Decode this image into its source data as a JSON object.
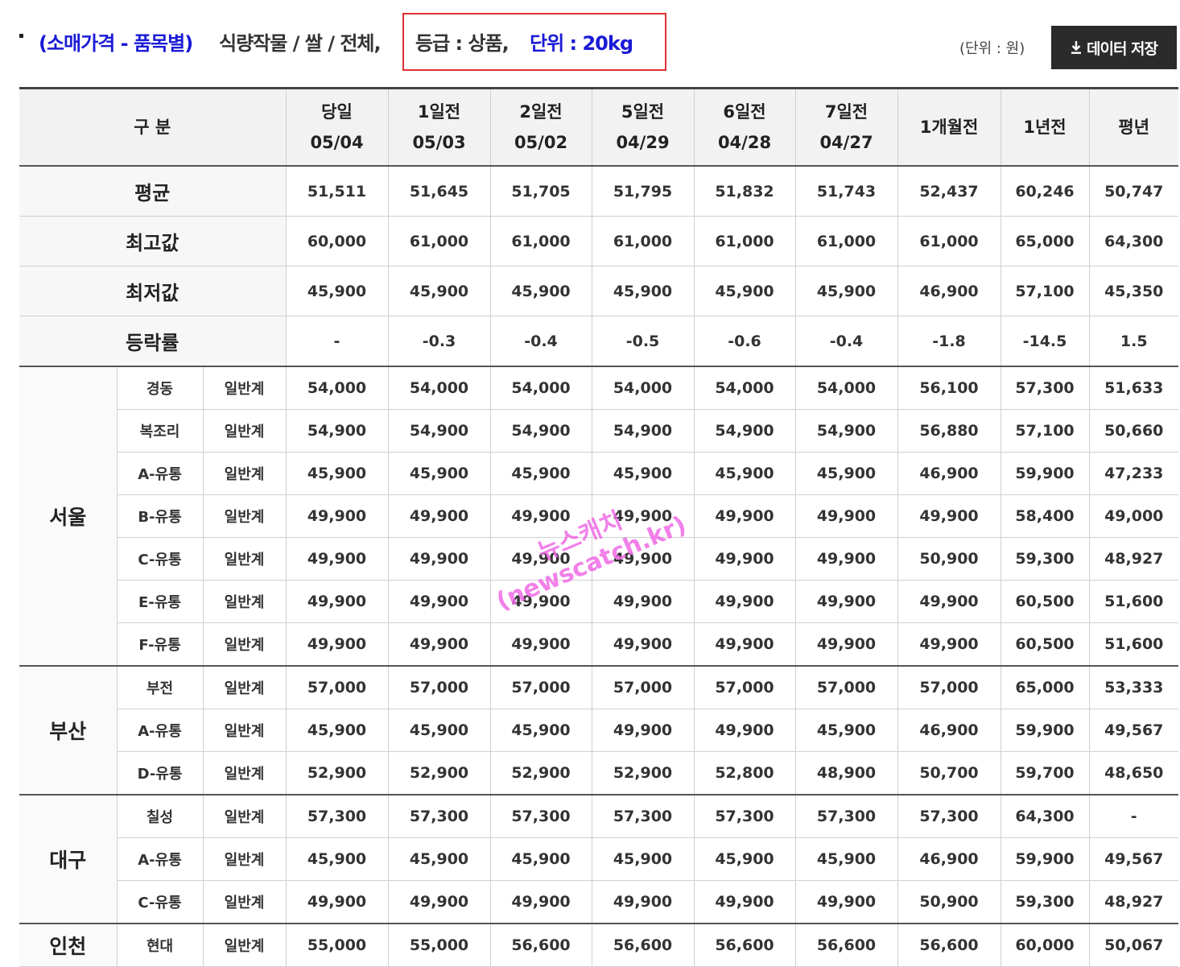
{
  "header": {
    "category": "(소매가격 - 품목별)",
    "path": "식량작물 / 쌀 / 전체,",
    "grade": "등급 : 상품,",
    "unit": "단위 : 20kg",
    "unit_note": "(단위 : 원)",
    "save_label": "데이터 저장",
    "save_icon": "download-icon"
  },
  "table": {
    "corner_label": "구 분",
    "columns": [
      {
        "line1": "당일",
        "line2": "05/04"
      },
      {
        "line1": "1일전",
        "line2": "05/03"
      },
      {
        "line1": "2일전",
        "line2": "05/02"
      },
      {
        "line1": "5일전",
        "line2": "04/29"
      },
      {
        "line1": "6일전",
        "line2": "04/28"
      },
      {
        "line1": "7일전",
        "line2": "04/27"
      },
      {
        "line1": "1개월전",
        "line2": ""
      },
      {
        "line1": "1년전",
        "line2": ""
      },
      {
        "line1": "평년",
        "line2": ""
      }
    ],
    "summary": [
      {
        "label": "평균",
        "values": [
          "51,511",
          "51,645",
          "51,705",
          "51,795",
          "51,832",
          "51,743",
          "52,437",
          "60,246",
          "50,747"
        ]
      },
      {
        "label": "최고값",
        "values": [
          "60,000",
          "61,000",
          "61,000",
          "61,000",
          "61,000",
          "61,000",
          "61,000",
          "65,000",
          "64,300"
        ]
      },
      {
        "label": "최저값",
        "values": [
          "45,900",
          "45,900",
          "45,900",
          "45,900",
          "45,900",
          "45,900",
          "46,900",
          "57,100",
          "45,350"
        ]
      },
      {
        "label": "등락률",
        "values": [
          "-",
          "-0.3",
          "-0.4",
          "-0.5",
          "-0.6",
          "-0.4",
          "-1.8",
          "-14.5",
          "1.5"
        ]
      }
    ],
    "regions": [
      {
        "name": "서울",
        "rows": [
          {
            "market": "경동",
            "kind": "일반계",
            "values": [
              "54,000",
              "54,000",
              "54,000",
              "54,000",
              "54,000",
              "54,000",
              "56,100",
              "57,300",
              "51,633"
            ]
          },
          {
            "market": "복조리",
            "kind": "일반계",
            "values": [
              "54,900",
              "54,900",
              "54,900",
              "54,900",
              "54,900",
              "54,900",
              "56,880",
              "57,100",
              "50,660"
            ]
          },
          {
            "market": "A-유통",
            "kind": "일반계",
            "values": [
              "45,900",
              "45,900",
              "45,900",
              "45,900",
              "45,900",
              "45,900",
              "46,900",
              "59,900",
              "47,233"
            ]
          },
          {
            "market": "B-유통",
            "kind": "일반계",
            "values": [
              "49,900",
              "49,900",
              "49,900",
              "49,900",
              "49,900",
              "49,900",
              "49,900",
              "58,400",
              "49,000"
            ]
          },
          {
            "market": "C-유통",
            "kind": "일반계",
            "values": [
              "49,900",
              "49,900",
              "49,900",
              "49,900",
              "49,900",
              "49,900",
              "50,900",
              "59,300",
              "48,927"
            ]
          },
          {
            "market": "E-유통",
            "kind": "일반계",
            "values": [
              "49,900",
              "49,900",
              "49,900",
              "49,900",
              "49,900",
              "49,900",
              "49,900",
              "60,500",
              "51,600"
            ]
          },
          {
            "market": "F-유통",
            "kind": "일반계",
            "values": [
              "49,900",
              "49,900",
              "49,900",
              "49,900",
              "49,900",
              "49,900",
              "49,900",
              "60,500",
              "51,600"
            ]
          }
        ]
      },
      {
        "name": "부산",
        "rows": [
          {
            "market": "부전",
            "kind": "일반계",
            "values": [
              "57,000",
              "57,000",
              "57,000",
              "57,000",
              "57,000",
              "57,000",
              "57,000",
              "65,000",
              "53,333"
            ]
          },
          {
            "market": "A-유통",
            "kind": "일반계",
            "values": [
              "45,900",
              "45,900",
              "45,900",
              "49,900",
              "49,900",
              "45,900",
              "46,900",
              "59,900",
              "49,567"
            ]
          },
          {
            "market": "D-유통",
            "kind": "일반계",
            "values": [
              "52,900",
              "52,900",
              "52,900",
              "52,900",
              "52,800",
              "48,900",
              "50,700",
              "59,700",
              "48,650"
            ]
          }
        ]
      },
      {
        "name": "대구",
        "rows": [
          {
            "market": "칠성",
            "kind": "일반계",
            "values": [
              "57,300",
              "57,300",
              "57,300",
              "57,300",
              "57,300",
              "57,300",
              "57,300",
              "64,300",
              "-"
            ]
          },
          {
            "market": "A-유통",
            "kind": "일반계",
            "values": [
              "45,900",
              "45,900",
              "45,900",
              "45,900",
              "45,900",
              "45,900",
              "46,900",
              "59,900",
              "49,567"
            ]
          },
          {
            "market": "C-유통",
            "kind": "일반계",
            "values": [
              "49,900",
              "49,900",
              "49,900",
              "49,900",
              "49,900",
              "49,900",
              "50,900",
              "59,300",
              "48,927"
            ]
          }
        ]
      },
      {
        "name": "인천",
        "rows": [
          {
            "market": "현대",
            "kind": "일반계",
            "values": [
              "55,000",
              "55,000",
              "56,600",
              "56,600",
              "56,600",
              "56,600",
              "56,600",
              "60,000",
              "50,067"
            ]
          }
        ]
      }
    ]
  },
  "watermark": {
    "line1": "뉴스캐치",
    "line2": "(newscatch.kr)"
  },
  "colors": {
    "accent_blue": "#1a1ad6",
    "highlight_red": "#e03030",
    "watermark_pink": "#f06be6",
    "button_bg": "#2b2b2b"
  }
}
